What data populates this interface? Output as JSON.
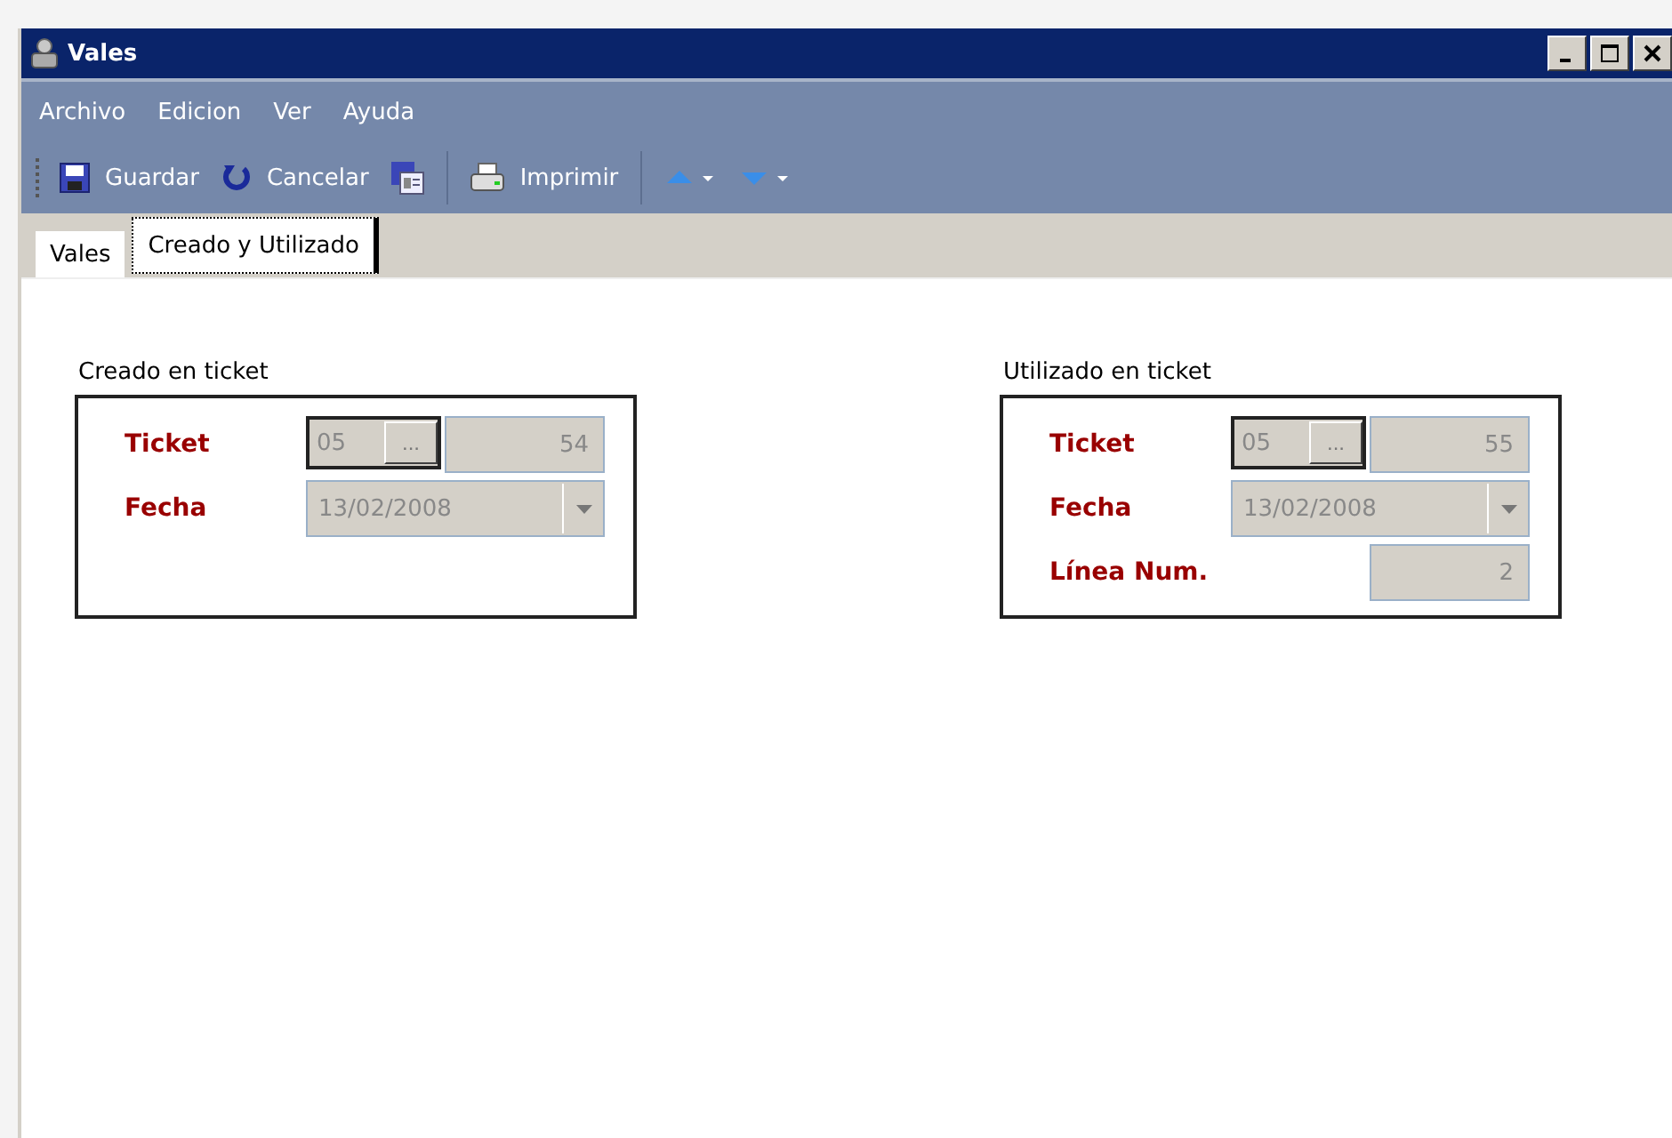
{
  "window": {
    "title": "Vales"
  },
  "menu": [
    "Archivo",
    "Edicion",
    "Ver",
    "Ayuda"
  ],
  "toolbar": [
    {
      "kind": "save",
      "label": "Guardar"
    },
    {
      "kind": "undo",
      "label": "Cancelar"
    },
    {
      "kind": "form"
    },
    {
      "kind": "separator"
    },
    {
      "kind": "print",
      "label": "Imprimir"
    },
    {
      "kind": "separator"
    },
    {
      "kind": "up"
    },
    {
      "kind": "down"
    }
  ],
  "tabs": [
    {
      "label": "Vales",
      "selected": false
    },
    {
      "label": "Creado y Utilizado",
      "selected": true
    }
  ],
  "groups": [
    {
      "title": "Creado en ticket",
      "rows": [
        {
          "kind": "ticket",
          "label": "Ticket",
          "prefix": "05",
          "button": "...",
          "value": "54"
        },
        {
          "kind": "date",
          "label": "Fecha",
          "value": "13/02/2008"
        }
      ]
    },
    {
      "title": "Utilizado en ticket",
      "rows": [
        {
          "kind": "ticket",
          "label": "Ticket",
          "prefix": "05",
          "button": "...",
          "value": "55"
        },
        {
          "kind": "date",
          "label": "Fecha",
          "value": "13/02/2008"
        },
        {
          "kind": "number",
          "label": "Línea Num.",
          "value": "2"
        }
      ]
    }
  ]
}
